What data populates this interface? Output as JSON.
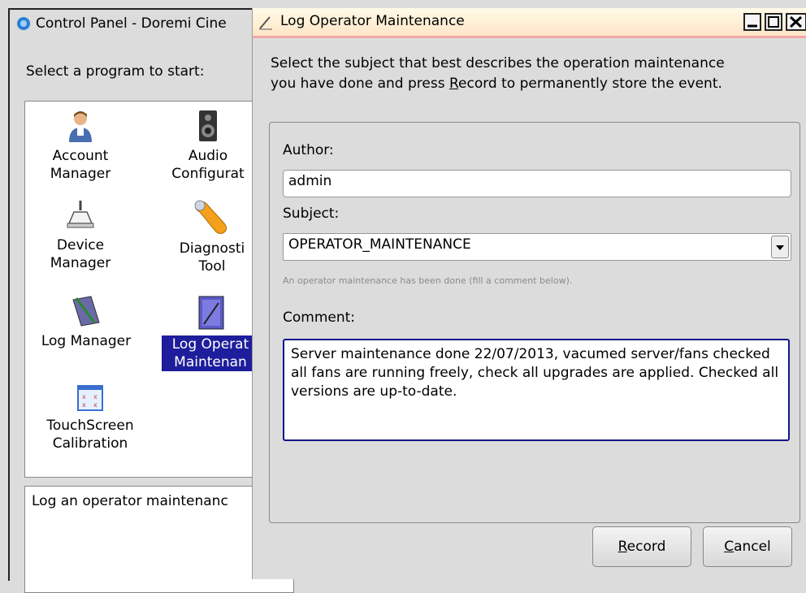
{
  "control_panel": {
    "title": "Control Panel - Doremi Cine",
    "prompt": "Select a program to start:",
    "items": [
      {
        "line1": "Account",
        "line2": "Manager",
        "icon": "user-icon"
      },
      {
        "line1": "Audio",
        "line2": "Configurat",
        "icon": "speaker-icon"
      },
      {
        "line1": "Device",
        "line2": "Manager",
        "icon": "device-icon"
      },
      {
        "line1": "Diagnosti",
        "line2": "Tool",
        "icon": "wrench-icon"
      },
      {
        "line1": "Log Manager",
        "line2": "",
        "icon": "notebook-icon"
      },
      {
        "line1": "Log Operat",
        "line2": "Maintenan",
        "icon": "log-maintenance-icon",
        "selected": true
      },
      {
        "line1": "TouchScreen",
        "line2": "Calibration",
        "icon": "calibration-icon"
      }
    ],
    "description": "Log an operator maintenanc"
  },
  "dialog": {
    "title": "Log Operator Maintenance",
    "intro_line1": "Select the subject that best describes the operation maintenance",
    "intro_pre": "you have done and press ",
    "intro_key": "R",
    "intro_post": "ecord to permanently store the event.",
    "author_label": "Author:",
    "author_value": "admin",
    "subject_label": "Subject:",
    "subject_value": "OPERATOR_MAINTENANCE",
    "subject_hint": "An operator maintenance has been done (fill a comment below).",
    "comment_label": "Comment:",
    "comment_value": "Server maintenance done 22/07/2013, vacumed server/fans checked all fans are running freely, check all upgrades are applied. Checked all versions are up-to-date.",
    "record_key": "R",
    "record_rest": "ecord",
    "cancel_key": "C",
    "cancel_rest": "ancel"
  },
  "colors": {
    "selection": "#1e1e9c",
    "comment_border": "#14148a",
    "title_bar": "#ffe5c8"
  }
}
